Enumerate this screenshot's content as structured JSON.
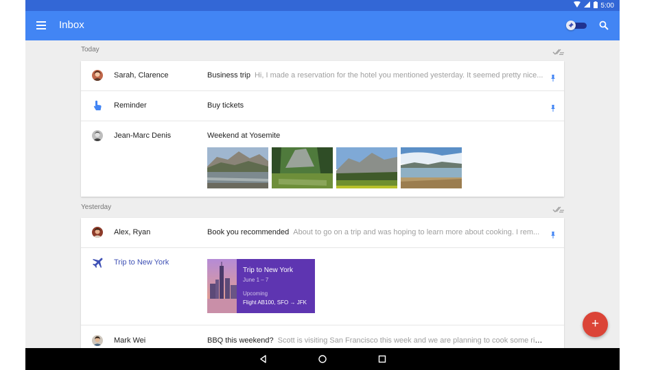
{
  "status_bar": {
    "time": "5:00",
    "icons": [
      "wifi-icon",
      "signal-icon",
      "battery-icon"
    ]
  },
  "app_bar": {
    "title": "Inbox",
    "icons": [
      "menu-icon",
      "pin-toggle",
      "search-icon"
    ]
  },
  "sections": [
    {
      "label": "Today",
      "items": [
        {
          "sender": "Sarah, Clarence",
          "subject": "Business trip",
          "snippet": "Hi, I made a reservation for the hotel you mentioned yesterday. It seemed pretty nice...",
          "pinned": true
        },
        {
          "sender": "Reminder",
          "subject": "Buy tickets",
          "snippet": "",
          "pinned": true
        },
        {
          "sender": "Jean-Marc Denis",
          "subject": "Weekend at Yosemite",
          "snippet": "",
          "pinned": false,
          "photo_count": 4
        }
      ]
    },
    {
      "label": "Yesterday",
      "items": [
        {
          "sender": "Alex, Ryan",
          "subject": "Book you recommended",
          "snippet": "About to go on a trip and was hoping to learn more about cooking. I rem...",
          "pinned": true
        },
        {
          "sender": "Trip to New York",
          "trip": {
            "title": "Trip to New York",
            "dates": "June 1 – 7",
            "status": "Upcoming",
            "flight": "Flight AB100, SFO → JFK"
          }
        },
        {
          "sender": "Mark Wei",
          "subject": "BBQ this weekend?",
          "snippet": "Scott is visiting San Francisco this week and we are planning to cook some ribs ...",
          "pinned": false
        }
      ]
    }
  ],
  "fab": {
    "label": "+"
  },
  "nav_bar": {
    "icons": [
      "back-icon",
      "home-icon",
      "recents-icon"
    ]
  },
  "colors": {
    "app_bar": "#4285f4",
    "status_bar": "#3367d6",
    "fab": "#db4437",
    "trip_card": "#5e35b1",
    "trip_title_text": "#3f51b5",
    "pin": "#4285f4"
  }
}
